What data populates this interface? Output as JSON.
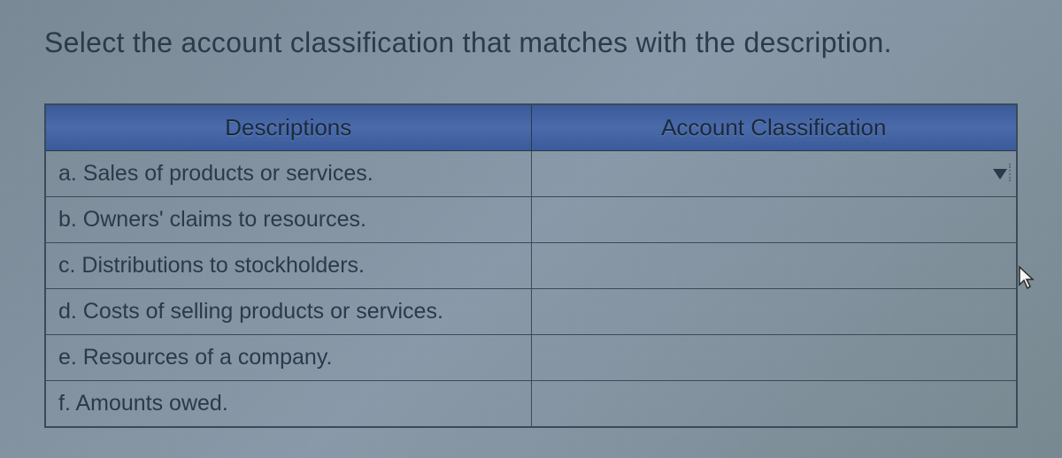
{
  "prompt": "Select the account classification that matches with the description.",
  "table": {
    "headers": {
      "descriptions": "Descriptions",
      "classification": "Account Classification"
    },
    "rows": [
      {
        "label": "a. Sales of products or services.",
        "value": ""
      },
      {
        "label": "b. Owners' claims to resources.",
        "value": ""
      },
      {
        "label": "c. Distributions to stockholders.",
        "value": ""
      },
      {
        "label": "d. Costs of selling products or services.",
        "value": ""
      },
      {
        "label": "e. Resources of a company.",
        "value": ""
      },
      {
        "label": "f. Amounts owed.",
        "value": ""
      }
    ]
  }
}
